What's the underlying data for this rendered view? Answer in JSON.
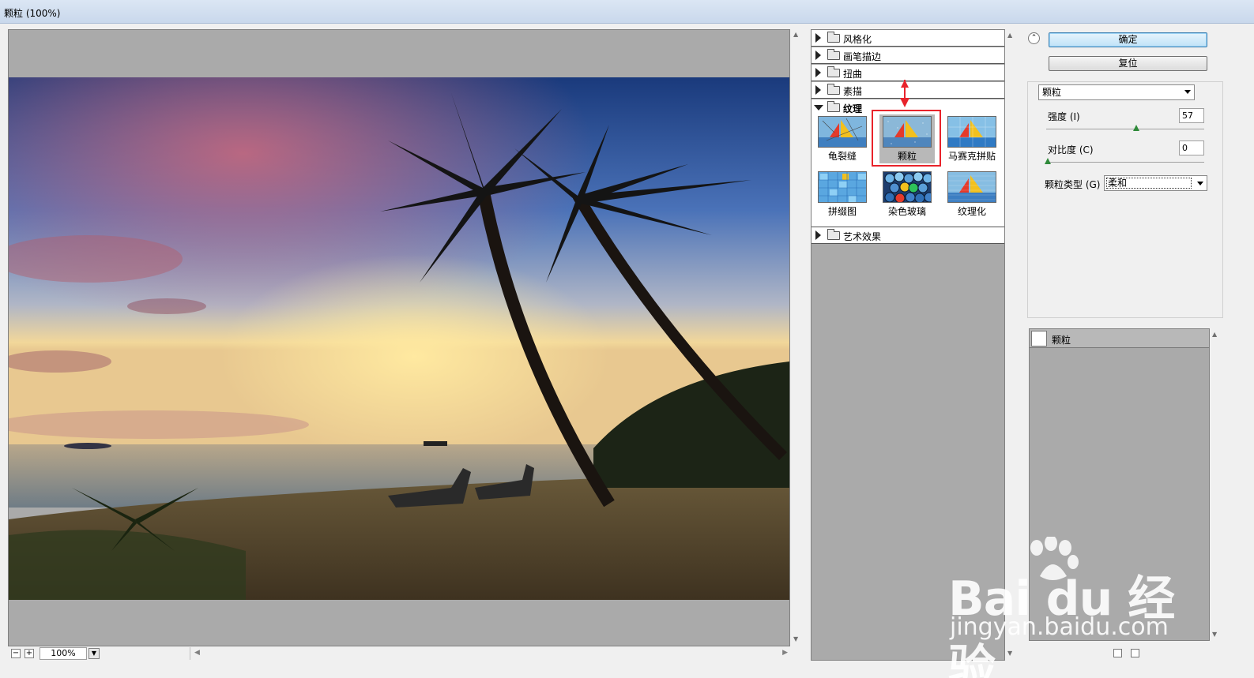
{
  "window": {
    "title": "颗粒 (100%)"
  },
  "preview": {
    "zoom": "100%",
    "zoom_out": "−",
    "zoom_in": "+"
  },
  "gallery": {
    "categories": [
      {
        "label": "风格化",
        "expanded": false
      },
      {
        "label": "画笔描边",
        "expanded": false
      },
      {
        "label": "扭曲",
        "expanded": false
      },
      {
        "label": "素描",
        "expanded": false
      },
      {
        "label": "纹理",
        "expanded": true
      },
      {
        "label": "艺术效果",
        "expanded": false
      }
    ],
    "texture_filters": [
      {
        "label": "龟裂缝"
      },
      {
        "label": "颗粒",
        "selected": true
      },
      {
        "label": "马赛克拼贴"
      },
      {
        "label": "拼缀图"
      },
      {
        "label": "染色玻璃"
      },
      {
        "label": "纹理化"
      }
    ]
  },
  "settings": {
    "ok": "确定",
    "reset": "复位",
    "filter": "颗粒",
    "intensity": {
      "label": "强度 (I)",
      "value": "57",
      "fraction": 0.57
    },
    "contrast": {
      "label": "对比度 (C)",
      "value": "0",
      "fraction": 0.0
    },
    "grain_type": {
      "label": "颗粒类型 (G) :",
      "value": "柔和"
    }
  },
  "layers": {
    "items": [
      {
        "label": "颗粒"
      }
    ]
  },
  "watermark": {
    "logo": "Bai du 经验",
    "url": "jingyan.baidu.com"
  },
  "colors": {
    "accent_red": "#e8232b",
    "panel_gray": "#aaaaaa",
    "primary_button": "#bfe2f8"
  }
}
